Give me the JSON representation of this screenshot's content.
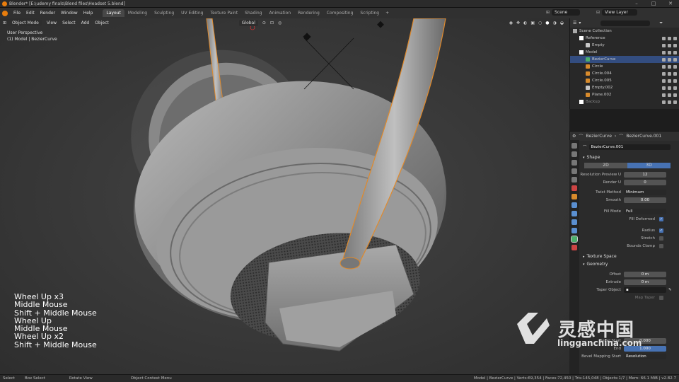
{
  "window": {
    "title": "Blender* [E:\\udemy finals\\Blend files\\Headset 5.blend]"
  },
  "menu": [
    "File",
    "Edit",
    "Render",
    "Window",
    "Help"
  ],
  "workspaces": [
    {
      "label": "Layout",
      "active": true
    },
    {
      "label": "Modeling"
    },
    {
      "label": "Sculpting"
    },
    {
      "label": "UV Editing"
    },
    {
      "label": "Texture Paint"
    },
    {
      "label": "Shading"
    },
    {
      "label": "Animation"
    },
    {
      "label": "Rendering"
    },
    {
      "label": "Compositing"
    },
    {
      "label": "Scripting"
    }
  ],
  "scene": {
    "label": "Scene",
    "view_layer": "View Layer"
  },
  "viewport": {
    "mode": "Object Mode",
    "menus": [
      "View",
      "Select",
      "Add",
      "Object"
    ],
    "orientation": "Global",
    "perspective": "User Perspective",
    "object_info": "(1) Model | BezierCurve"
  },
  "key_log": [
    "Wheel Up x3",
    "Middle Mouse",
    "Shift + Middle Mouse",
    "Wheel Up",
    "Middle Mouse",
    "Wheel Up x2",
    "Shift + Middle Mouse"
  ],
  "outliner": {
    "rows": [
      {
        "label": "Scene Collection",
        "indent": 0
      },
      {
        "label": "Reference",
        "indent": 1
      },
      {
        "label": "Empty",
        "indent": 2
      },
      {
        "label": "Model",
        "indent": 1
      },
      {
        "label": "BezierCurve",
        "indent": 2,
        "selected": true
      },
      {
        "label": "Circle",
        "indent": 2
      },
      {
        "label": "Circle.004",
        "indent": 2
      },
      {
        "label": "Circle.005",
        "indent": 2
      },
      {
        "label": "Empty.002",
        "indent": 2
      },
      {
        "label": "Plane.002",
        "indent": 2
      },
      {
        "label": "Backup",
        "indent": 1
      }
    ]
  },
  "properties": {
    "breadcrumb": [
      "BezierCurve",
      "BezierCurve.001"
    ],
    "datablock": "BezierCurve.001",
    "shape": {
      "title": "Shape",
      "mode_2d": "2D",
      "mode_3d": "3D",
      "resolution_preview_label": "Resolution Preview U",
      "resolution_preview": "12",
      "render_u_label": "Render U",
      "render_u": "0",
      "twist_method_label": "Twist Method",
      "twist_method": "Minimum",
      "smooth_label": "Smooth",
      "smooth": "0.00",
      "fill_mode_label": "Fill Mode",
      "fill_mode": "Full",
      "fill_deformed": "Fill Deformed",
      "radius": "Radius",
      "stretch": "Stretch",
      "bounds_clamp": "Bounds Clamp"
    },
    "texture_space": "Texture Space",
    "geometry": {
      "title": "Geometry",
      "offset_label": "Offset",
      "offset": "0 m",
      "extrude_label": "Extrude",
      "extrude": "0 m",
      "taper_label": "Taper Object",
      "map_taper": "Map Taper"
    },
    "bevel": {
      "start_label": "Bevel Start",
      "start": "0.000",
      "end_label": "End",
      "end": "1.000",
      "mapping_start_label": "Bevel Mapping Start",
      "mapping_start": "Resolution"
    }
  },
  "statusbar": {
    "select": "Select",
    "box_select": "Box Select",
    "rotate_view": "Rotate View",
    "context_menu": "Object Context Menu",
    "stats": "Model | BezierCurve | Verts:69,354 | Faces:72,450 | Tris:145,048 | Objects:1/7 | Mem: 66.1 MiB | v2.82.7"
  },
  "watermark": {
    "cn": "灵感中国",
    "url": "lingganchina.com"
  },
  "colors": {
    "accent": "#4772b3",
    "selection": "#e08a2c",
    "viewport_bg": "#3a3a3a"
  }
}
